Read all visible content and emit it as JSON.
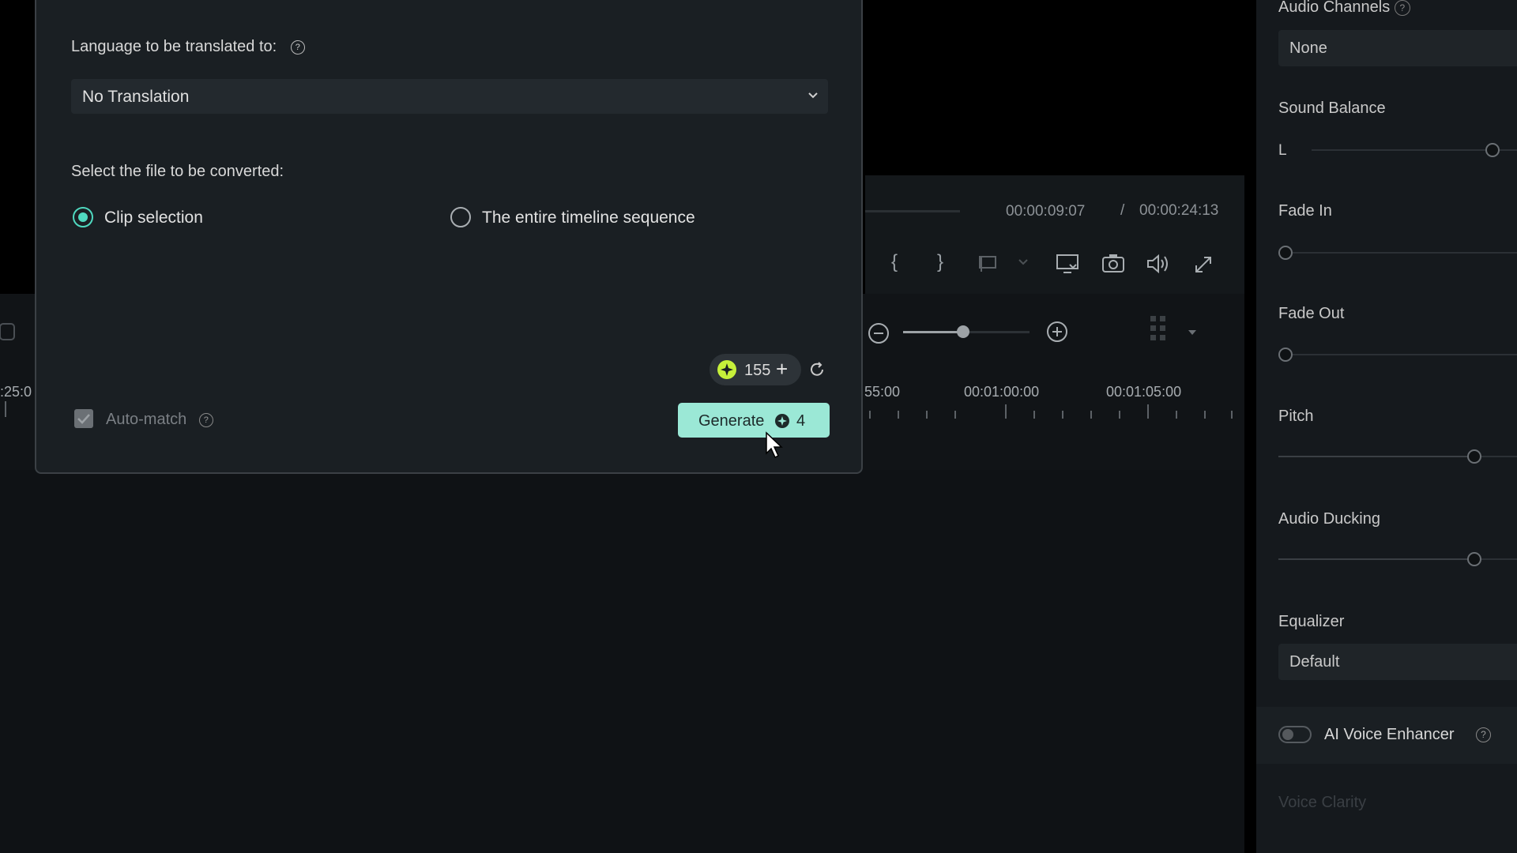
{
  "dialog": {
    "language_label": "Language to be translated to:",
    "language_value": "No Translation",
    "file_label": "Select the file to be converted:",
    "radio_clip": "Clip selection",
    "radio_timeline": "The entire timeline sequence",
    "selected_option": "Clip selection",
    "credits": "155",
    "auto_match_label": "Auto-match",
    "auto_match_checked": true,
    "generate_label": "Generate",
    "generate_cost": "4"
  },
  "player": {
    "current_time": "00:00:09:07",
    "separator": "/",
    "total_time": "00:00:24:13"
  },
  "timeline": {
    "ruler": [
      "55:00",
      "00:01:00:00",
      "00:01:05:00"
    ],
    "left_ruler": ":25:0"
  },
  "right_panel": {
    "audio_channels_label": "Audio Channels",
    "audio_channels_value": "None",
    "sound_balance_label": "Sound Balance",
    "sound_balance_side": "L",
    "fade_in_label": "Fade In",
    "fade_out_label": "Fade Out",
    "pitch_label": "Pitch",
    "audio_ducking_label": "Audio Ducking",
    "equalizer_label": "Equalizer",
    "equalizer_value": "Default",
    "ai_voice_enhancer_label": "AI Voice Enhancer",
    "voice_clarity_label": "Voice Clarity"
  },
  "colors": {
    "accent": "#4fd8bf",
    "generate_bg": "#9be8d6",
    "credit_icon": "#c6f03a"
  }
}
